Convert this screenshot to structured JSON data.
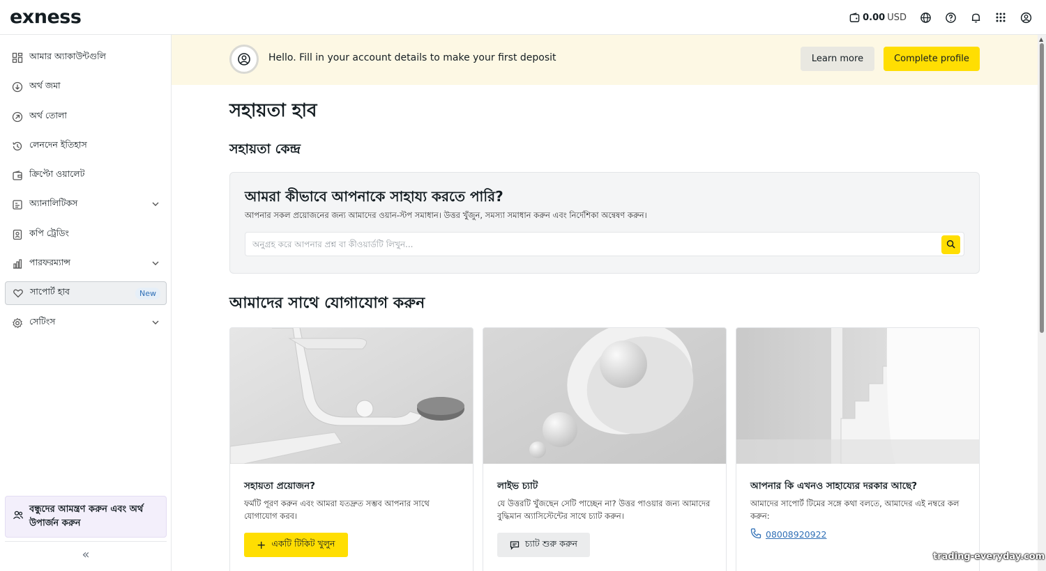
{
  "header": {
    "logo": "exness",
    "balance_amount": "0.00",
    "balance_currency": "USD"
  },
  "sidebar": {
    "items": [
      {
        "label": "আমার অ্যাকাউন্টগুলি",
        "icon": "grid-icon"
      },
      {
        "label": "অর্থ জমা",
        "icon": "deposit-icon"
      },
      {
        "label": "অর্থ তোলা",
        "icon": "withdraw-icon"
      },
      {
        "label": "লেনদেন ইতিহাস",
        "icon": "history-icon"
      },
      {
        "label": "ক্রিপ্টো ওয়ালেট",
        "icon": "wallet-icon"
      },
      {
        "label": "অ্যানালিটিকস",
        "icon": "analytics-icon"
      },
      {
        "label": "কপি ট্রেডিং",
        "icon": "copy-trading-icon"
      },
      {
        "label": "পারফরম্যান্স",
        "icon": "performance-icon"
      },
      {
        "label": "সাপোর্ট হাব",
        "icon": "heart-icon",
        "badge": "New"
      },
      {
        "label": "সেটিংস",
        "icon": "gear-icon"
      }
    ],
    "invite": "বন্ধুদের আমন্ত্রণ করুন এবং অর্থ উপার্জন করুন"
  },
  "banner": {
    "message": "Hello. Fill in your account details to make your first deposit",
    "learn_more": "Learn more",
    "complete_profile": "Complete profile"
  },
  "main": {
    "title": "সহায়তা হাব",
    "help_center": "সহায়তা কেন্দ্র",
    "search_title": "আমরা কীভাবে আপনাকে সাহায্য করতে পারি?",
    "search_subtitle": "আপনার সকল প্রয়োজনের জন্য আমাদের ওয়ান-স্টপ সমাধান। উত্তর খুঁজুন, সমস্যা সমাধান করুন এবং নির্দেশিকা অন্বেষণ করুন।",
    "search_placeholder": "অনুগ্রহ করে আপনার প্রশ্ন বা কীওয়ার্ডটি লিখুন...",
    "contact_title": "আমাদের সাথে যোগাযোগ করুন"
  },
  "cards": [
    {
      "title": "সহায়তা প্রয়োজন?",
      "desc": "ফর্মটি পূরণ করুন এবং আমরা যতদ্রুত সম্ভব আপনার সাথে যোগাযোগ করব।",
      "button": "একটি টিকিট খুলুন"
    },
    {
      "title": "লাইভ চ্যাট",
      "desc": "যে উত্তরটি খুঁজছেন সেটি পাচ্ছেন না? উত্তর পাওয়ার জন্য আমাদের বুদ্ধিমান অ্যাসিস্টেন্টের সাথে চ্যাট করুন।",
      "button": "চ্যাট শুরু করুন"
    },
    {
      "title": "আপনার কি এখনও সাহায্যের দরকার আছে?",
      "desc": "আমাদের সাপোর্ট টিমের সঙ্গে কথা বলতে, আমাদের এই নম্বরে কল করুন:",
      "phone": "08008920922"
    }
  ],
  "watermark": "trading-everyday.com",
  "colors": {
    "accent_yellow": "#ffde02",
    "banner_bg": "#fdf8e4",
    "link_blue": "#2f6fb6",
    "invite_bg": "#f3effb"
  }
}
